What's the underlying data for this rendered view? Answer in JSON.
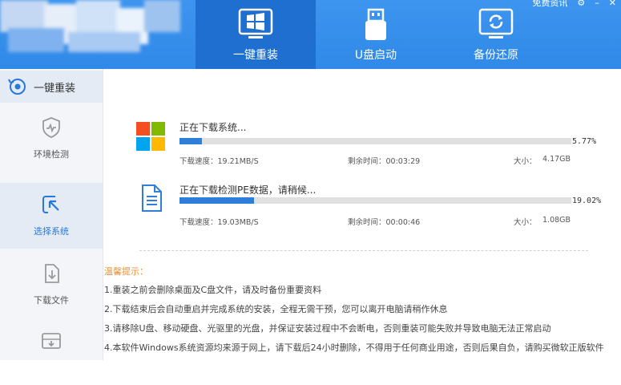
{
  "window_controls": {
    "feedback": "免费资讯",
    "settings_icon": "gear-icon",
    "minimize": "–",
    "close": "✕"
  },
  "colors": {
    "header_blue": "#3189e8",
    "active_tab": "#1f6fd0",
    "progress_blue": "#2f7fd8",
    "tip_orange": "#e8913a"
  },
  "tabs": [
    {
      "label": "一键重装",
      "icon": "windows-monitor-icon",
      "active": true
    },
    {
      "label": "U盘启动",
      "icon": "usb-drive-icon",
      "active": false
    },
    {
      "label": "备份还原",
      "icon": "backup-restore-icon",
      "active": false
    }
  ],
  "sidebar": {
    "top": {
      "label": "一键重装",
      "icon": "reinstall-icon"
    },
    "items": [
      {
        "label": "环境检测",
        "icon": "shield-pulse-icon",
        "active": false
      },
      {
        "label": "选择系统",
        "icon": "cursor-select-icon",
        "active": true
      },
      {
        "label": "下载文件",
        "icon": "download-file-icon",
        "active": false
      },
      {
        "label": "",
        "icon": "install-box-icon",
        "active": false
      }
    ]
  },
  "downloads": [
    {
      "icon": "windows-logo-icon",
      "title": "正在下载系统...",
      "percent_text": "5.77%",
      "progress": 5.77,
      "speed": "下载速度：19.21MB/S",
      "remaining": "剩余时间：00:03:29",
      "size_label": "大小：",
      "size": "4.17GB"
    },
    {
      "icon": "document-icon",
      "title": "正在下载检测PE数据，请稍候...",
      "percent_text": "19.02%",
      "progress": 19.02,
      "speed": "下载速度：19.03MB/S",
      "remaining": "剩余时间：00:00:46",
      "size_label": "大小：",
      "size": "1.08GB"
    }
  ],
  "tips": {
    "title": "温馨提示：",
    "lines": [
      "1.重装之前会删除桌面及C盘文件，请及时备份重要资料",
      "2.下载结束后会自动重启并完成系统的安装，全程无需干预，您可以离开电脑请稍作休息",
      "3.请移除U盘、移动硬盘、光驱里的光盘，并保证安装过程中不会断电，否则重装可能失败并导致电脑无法正常启动",
      "4.本软件Windows系统资源均来源于网上，请下载后24小时删除，不得用于任何商业用途，否则后果自负，请购买微软正版软件"
    ]
  }
}
